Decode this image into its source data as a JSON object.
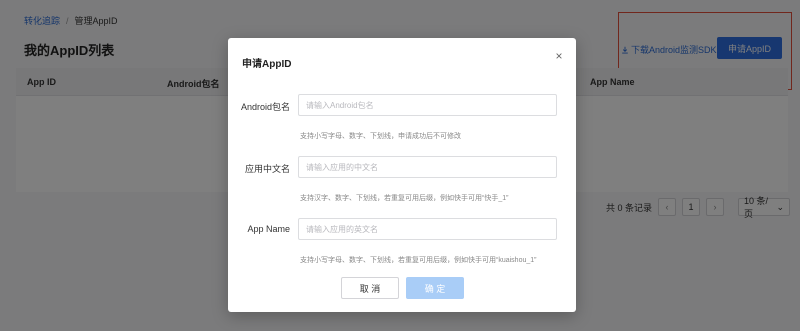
{
  "breadcrumb": {
    "parent": "转化追踪",
    "separator": "/",
    "current": "管理AppID"
  },
  "page": {
    "title": "我的AppID列表"
  },
  "toolbar": {
    "download_label": "下载Android监测SDK",
    "apply_label": "申请AppID"
  },
  "table": {
    "columns": [
      "App ID",
      "Android包名",
      "App Name"
    ]
  },
  "pagination": {
    "total_text": "共 0 条记录",
    "prev": "‹",
    "current_page": "1",
    "next": "›",
    "page_size": "10 条/页",
    "page_size_arrow": "⌄"
  },
  "modal": {
    "title": "申请AppID",
    "close_icon": "×",
    "fields": [
      {
        "label": "Android包名",
        "placeholder": "请输入Android包名",
        "value": "",
        "hint": "支持小写字母、数字、下划线，申请成功后不可修改"
      },
      {
        "label": "应用中文名",
        "placeholder": "请输入应用的中文名",
        "value": "",
        "hint": "支持汉字、数字、下划线，若重复可用后缀，例如快手可用“快手_1”"
      },
      {
        "label": "App Name",
        "placeholder": "请输入应用的英文名",
        "value": "",
        "hint": "支持小写字母、数字、下划线，若重复可用后缀，例如快手可用“kuaishou_1”"
      }
    ],
    "cancel_label": "取 消",
    "ok_label": "确 定"
  },
  "colors": {
    "primary": "#2f6fe0",
    "link": "#2d6dd6",
    "ok_disabled": "#a9cdf7",
    "highlight": "#e34f3a"
  }
}
